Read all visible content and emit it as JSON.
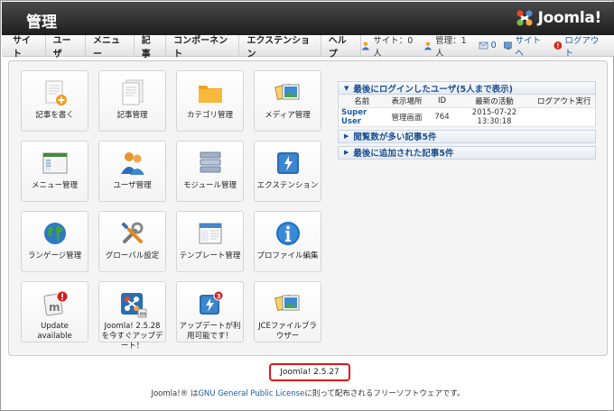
{
  "header": {
    "title": "管理",
    "logo_text": "Joomla!"
  },
  "menu": {
    "items": [
      "サイト",
      "ユーザ",
      "メニュー",
      "記事",
      "コンポーネント",
      "エクステンション",
      "ヘルプ"
    ]
  },
  "status": {
    "site_visitors": "サイト：0人",
    "admin_users": "管理：1人",
    "messages": "0",
    "view_site": "サイトへ",
    "logout": "ログアウト"
  },
  "tiles": [
    {
      "label": "記事を書く",
      "icon": "new-article-icon"
    },
    {
      "label": "記事管理",
      "icon": "article-manager-icon"
    },
    {
      "label": "カテゴリ管理",
      "icon": "folder-icon"
    },
    {
      "label": "メディア管理",
      "icon": "media-icon"
    },
    {
      "label": "メニュー管理",
      "icon": "menu-manager-icon"
    },
    {
      "label": "ユーザ管理",
      "icon": "users-icon"
    },
    {
      "label": "モジュール管理",
      "icon": "modules-icon"
    },
    {
      "label": "エクステンション",
      "icon": "extensions-icon"
    },
    {
      "label": "ランゲージ管理",
      "icon": "globe-icon"
    },
    {
      "label": "グローバル設定",
      "icon": "tools-icon"
    },
    {
      "label": "テンプレート管理",
      "icon": "template-icon"
    },
    {
      "label": "プロファイル編集",
      "icon": "info-icon"
    },
    {
      "label": "Update available",
      "icon": "update-alert-icon"
    },
    {
      "label": "Joomla! 2.5.28 を今すぐアップデート！",
      "icon": "joomla-update-icon"
    },
    {
      "label": "アップデートが利用可能です！",
      "icon": "extension-update-icon"
    },
    {
      "label": "JCEファイルブラウザー",
      "icon": "jce-browser-icon"
    }
  ],
  "logged_in": {
    "title": "最後にログインしたユーザ(5人まで表示)",
    "columns": [
      "名前",
      "表示場所",
      "ID",
      "最新の活動",
      "ログアウト実行"
    ],
    "rows": [
      {
        "name": "Super User",
        "location": "管理画面",
        "id": "764",
        "activity": "2015-07-22 13:30:18",
        "logout": ""
      }
    ]
  },
  "popular": {
    "title": "閲覧数が多い記事5件"
  },
  "recent": {
    "title": "最後に追加された記事5件"
  },
  "footer": {
    "version": "Joomla! 2.5.27",
    "license_prefix": "Joomla!® は",
    "license_link": "GNU General Public License",
    "license_suffix": "に則って配布されるフリーソフトウェアです。"
  },
  "colors": {
    "header_dark": "#1e1e1e",
    "link_blue": "#1a5aa8",
    "highlight_red": "#e0141a"
  }
}
